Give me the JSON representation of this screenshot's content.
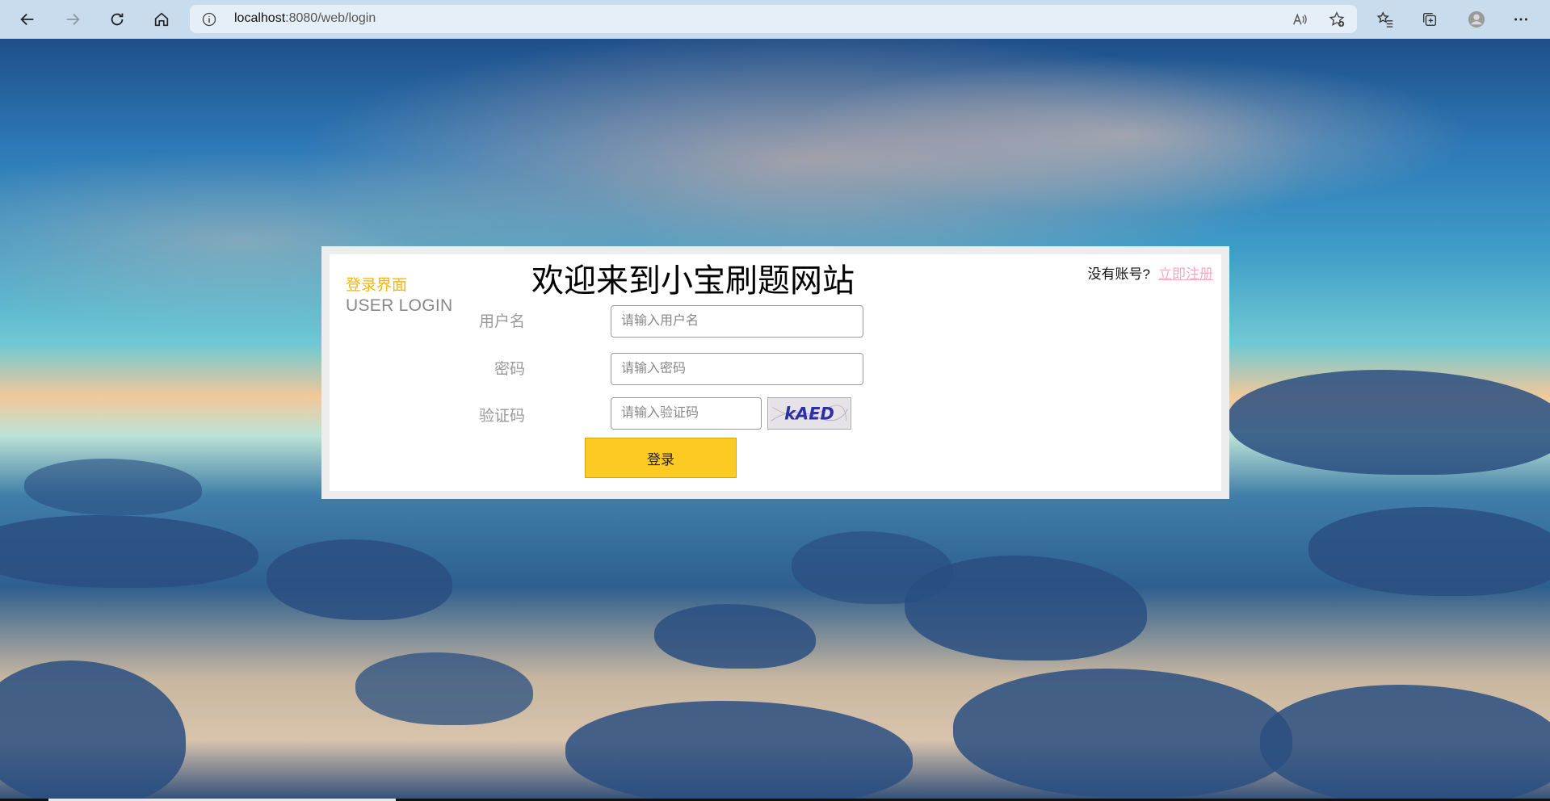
{
  "browser": {
    "url_host": "localhost",
    "url_path": ":8080/web/login"
  },
  "header": {
    "side_title_cn": "登录界面",
    "side_title_en": "USER LOGIN",
    "welcome": "欢迎来到小宝刷题网站"
  },
  "register": {
    "question": "没有账号?",
    "link_label": "立即注册"
  },
  "form": {
    "username_label": "用户名",
    "username_placeholder": "请输入用户名",
    "password_label": "密码",
    "password_placeholder": "请输入密码",
    "captcha_label": "验证码",
    "captcha_placeholder": "请输入验证码",
    "captcha_text": "kAED",
    "login_label": "登录"
  },
  "colors": {
    "accent": "#fccb23",
    "title_accent": "#f5b700",
    "link": "#f7a9c3"
  }
}
